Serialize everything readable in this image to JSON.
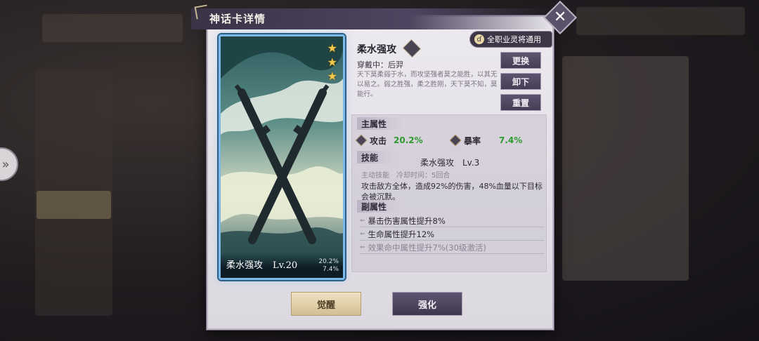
{
  "dialog": {
    "title": "神话卡详情",
    "close_label": "✕"
  },
  "card": {
    "name": "柔水强攻",
    "level": "Lv.20",
    "stars": 3,
    "mini_stat_1": "20.2%",
    "mini_stat_2": "7.4%"
  },
  "detail": {
    "title": "柔水强攻",
    "universal_badge": "全职业灵将通用",
    "wearing": "穿戴中：后羿",
    "description": "天下莫柔弱于水，而攻坚强者莫之能胜，以其无以易之。弱之胜强，柔之胜刚，天下莫不知，莫能行。",
    "buttons": {
      "replace": "更换",
      "unequip": "卸下",
      "reset": "重置"
    }
  },
  "main_attr": {
    "heading": "主属性",
    "attack_label": "攻击",
    "attack_value": "20.2%",
    "crit_label": "暴率",
    "crit_value": "7.4%"
  },
  "skill": {
    "heading": "技能",
    "name": "柔水强攻　Lv.3",
    "meta": "主动技能　冷却时间：5回合",
    "description": "攻击敌方全体，造成92%的伤害，48%血量以下目标会被沉默。"
  },
  "sub_attr": {
    "heading": "副属性",
    "items": [
      "暴击伤害属性提升8%",
      "生命属性提升12%",
      "效果命中属性提升7%(30级激活)"
    ]
  },
  "actions": {
    "awaken": "觉醒",
    "enhance": "强化"
  },
  "colors": {
    "stat_green": "#2e9a2e",
    "card_border": "#79b8e8",
    "star_gold": "#f2c84a"
  }
}
